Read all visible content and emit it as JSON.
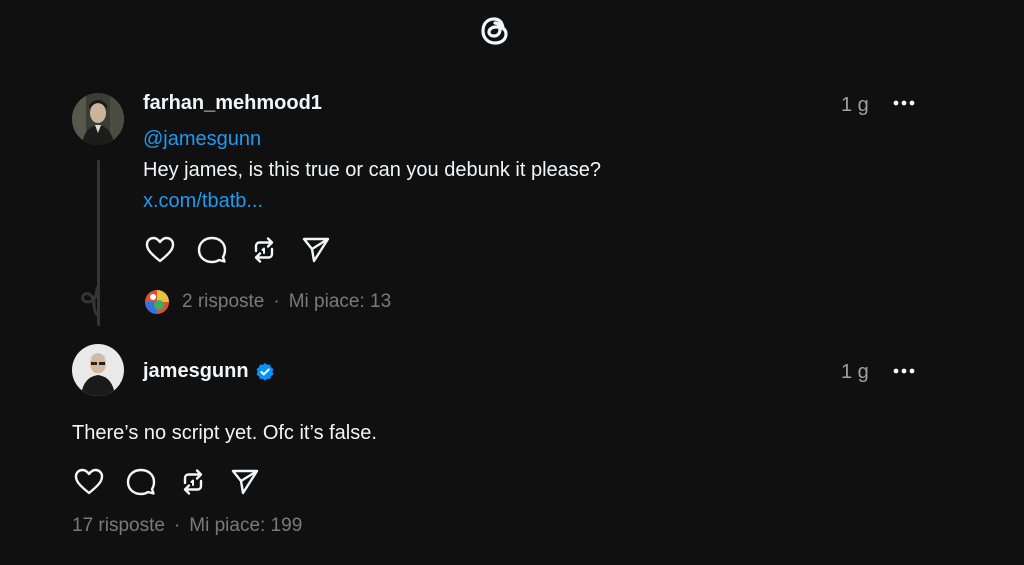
{
  "app": {
    "logo_icon": "threads-logo-icon"
  },
  "posts": [
    {
      "username": "farhan_mehmood1",
      "timestamp": "1 g",
      "mention": "@jamesgunn",
      "text": "Hey james, is this true or can you debunk it please?",
      "link": "x.com/tbatb...",
      "replies": "2 risposte",
      "likes": "Mi piace: 13",
      "separator": "·"
    },
    {
      "username": "jamesgunn",
      "verified": true,
      "timestamp": "1 g",
      "text": "There’s no script yet. Ofc it’s false.",
      "replies": "17 risposte",
      "likes": "Mi piace: 199",
      "separator": "·"
    }
  ],
  "colors": {
    "background": "#101010",
    "text": "#f3f5f7",
    "muted": "#7a7a7a",
    "link": "#1d9bf0",
    "verified": "#0095f6"
  }
}
